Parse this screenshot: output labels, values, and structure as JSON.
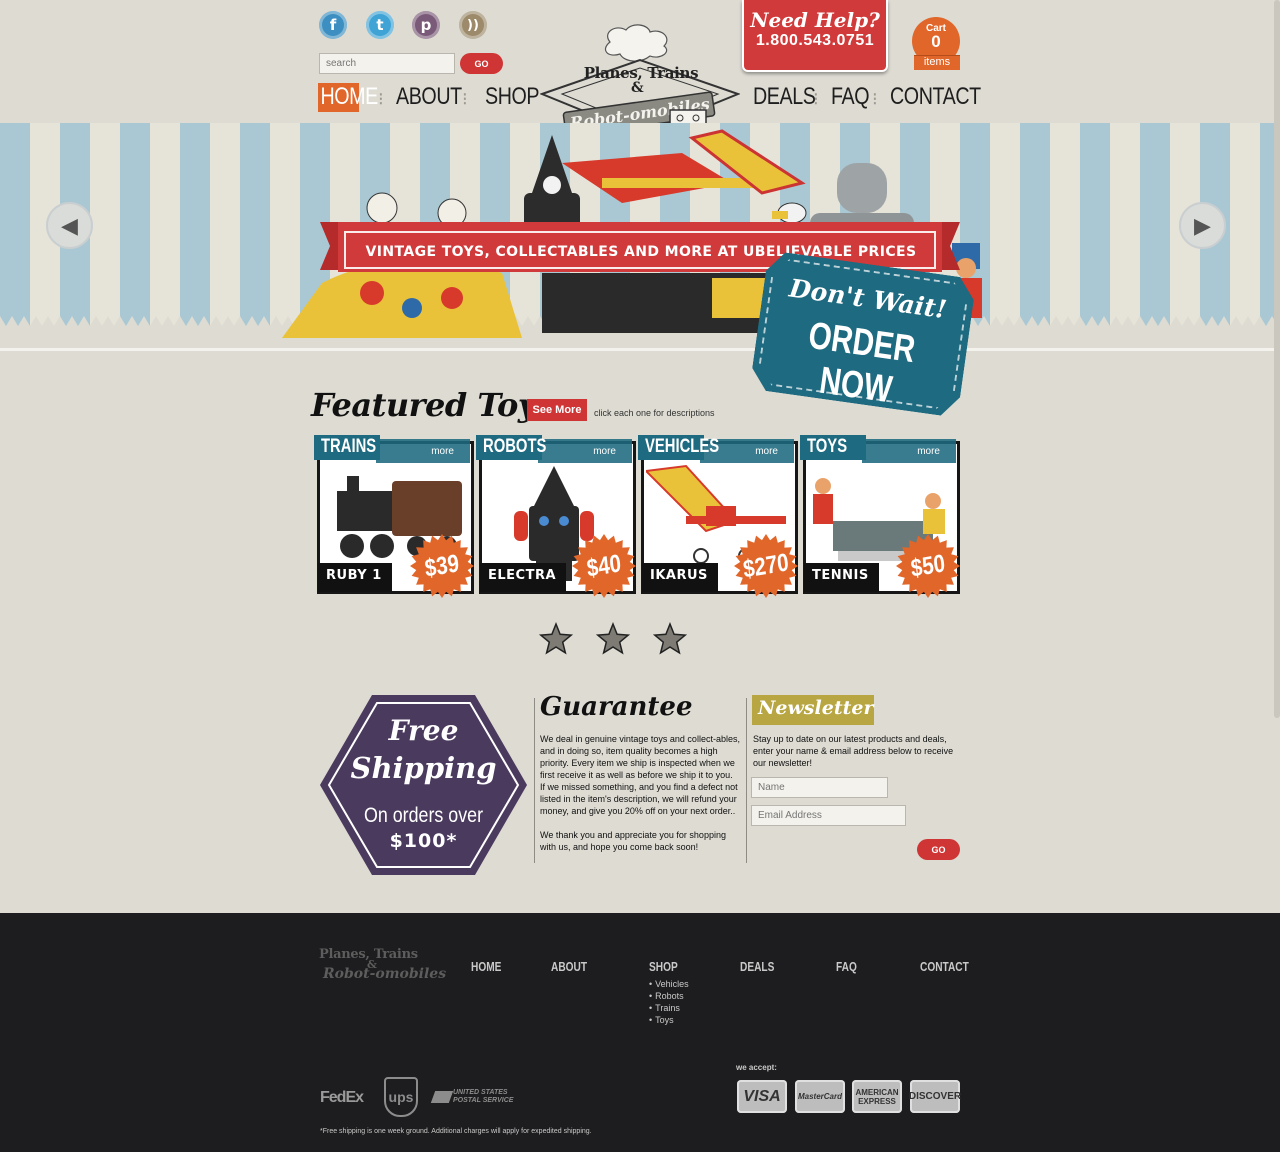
{
  "brand": {
    "line1": "Planes, Trains",
    "amp": "&",
    "line2": "Robot-omobiles"
  },
  "social": {
    "facebook_glyph": "f",
    "twitter_glyph": "t",
    "pinterest_glyph": "p",
    "rss_glyph": "))"
  },
  "search": {
    "placeholder": "search",
    "go_label": "GO"
  },
  "nav": {
    "items": [
      "HOME",
      "ABOUT",
      "SHOP",
      "DEALS",
      "FAQ",
      "CONTACT"
    ],
    "separator": "⁝"
  },
  "help": {
    "title": "Need Help?",
    "phone": "1.800.543.0751"
  },
  "cart": {
    "label": "Cart",
    "count": "0",
    "items_label": "items"
  },
  "hero": {
    "banner": "VINTAGE TOYS, COLLECTABLES AND MORE AT UBELIEVABLE PRICES",
    "order_top": "Don't Wait!",
    "order_bottom": "ORDER NOW",
    "prev_glyph": "◀",
    "next_glyph": "▶"
  },
  "featured": {
    "title": "Featured Toys",
    "see_more": "See More",
    "note": "click each one for descriptions",
    "cards": [
      {
        "category": "TRAINS",
        "more": "more",
        "name": "RUBY 1",
        "price": "$39"
      },
      {
        "category": "ROBOTS",
        "more": "more",
        "name": "ELECTRA",
        "price": "$40"
      },
      {
        "category": "VEHICLES",
        "more": "more",
        "name": "IKARUS",
        "price": "$270"
      },
      {
        "category": "TOYS",
        "more": "more",
        "name": "TENNIS",
        "price": "$50"
      }
    ]
  },
  "shipping": {
    "line1": "Free",
    "line2": "Shipping",
    "line3": "On orders over",
    "line4": "$100*"
  },
  "guarantee": {
    "title": "Guarantee",
    "para1": "We deal in genuine vintage toys and collect-ables, and in doing so, item quality becomes a high priority. Every item we ship is inspected when we first receive it as well as before we ship it to you. If we missed something, and you find a defect not listed in the item's description, we will refund your money, and give you 20% off on your next order..",
    "para2": "We thank you and appreciate you for shopping with us, and hope you come back soon!"
  },
  "newsletter": {
    "title": "Newsletter",
    "body": "Stay up to date on our latest products and deals, enter your name & email address below to receive our newsletter!",
    "name_placeholder": "Name",
    "email_placeholder": "Email Address",
    "go_label": "GO"
  },
  "footer": {
    "nav": [
      "HOME",
      "ABOUT",
      "SHOP",
      "DEALS",
      "FAQ",
      "CONTACT"
    ],
    "shop_sub": [
      "Vehicles",
      "Robots",
      "Trains",
      "Toys"
    ],
    "carriers": {
      "fedex": "FedEx",
      "ups": "ups",
      "usps": "UNITED STATES POSTAL SERVICE"
    },
    "we_accept": "we accept:",
    "cards": [
      "VISA",
      "MasterCard",
      "AMERICAN EXPRESS",
      "DISCOVER"
    ],
    "footnote": "*Free shipping is one week ground. Additional charges will apply for expedited shipping."
  },
  "colors": {
    "background": "#dddbd2",
    "accent_red": "#cf3535",
    "accent_orange": "#e1662a",
    "teal": "#1e6a80",
    "purple": "#4a3a5e",
    "olive": "#b7a641",
    "footer": "#1d1d1f"
  }
}
